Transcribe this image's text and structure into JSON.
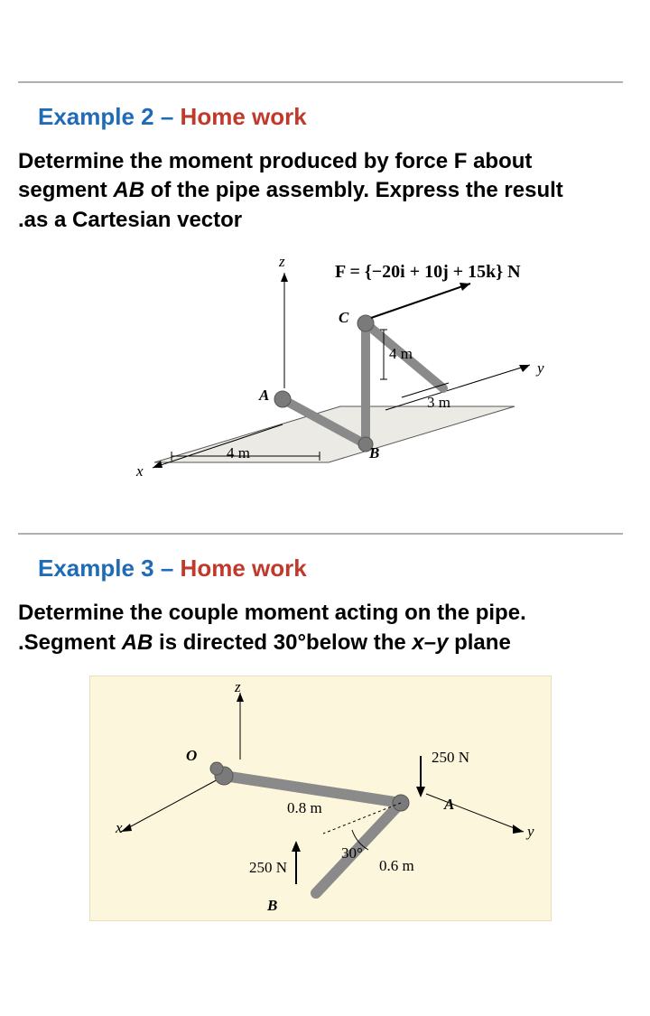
{
  "example2": {
    "heading_part1": "Example 2 – ",
    "heading_part2": "Home work",
    "prompt_l1": "Determine the moment produced by force F about",
    "prompt_l2_a": "segment ",
    "prompt_l2_b": "AB",
    "prompt_l2_c": " of the pipe assembly. Express the result",
    "prompt_l3": ".as a Cartesian vector",
    "fig": {
      "axis_z": "z",
      "axis_y": "y",
      "axis_x": "x",
      "ptA": "A",
      "ptB": "B",
      "ptC": "C",
      "dim4m_left": "4 m",
      "dim4m_vert": "4 m",
      "dim3m": "3 m",
      "forceF": "F = {−20i + 10j + 15k} N"
    }
  },
  "example3": {
    "heading_part1": "Example 3 – ",
    "heading_part2": "Home work",
    "prompt_l1": "Determine the couple moment acting on the pipe.",
    "prompt_l2_a": ".Segment ",
    "prompt_l2_b": "AB",
    "prompt_l2_c": " is directed 30°below the ",
    "prompt_l2_d": "x–y",
    "prompt_l2_e": " plane",
    "fig": {
      "axis_z": "z",
      "axis_y": "y",
      "axis_x": "x",
      "ptO": "O",
      "ptA": "A",
      "ptB": "B",
      "dim08m": "0.8 m",
      "dim06m": "0.6 m",
      "angle30": "30°",
      "f250_top": "250 N",
      "f250_bot": "250 N"
    }
  }
}
